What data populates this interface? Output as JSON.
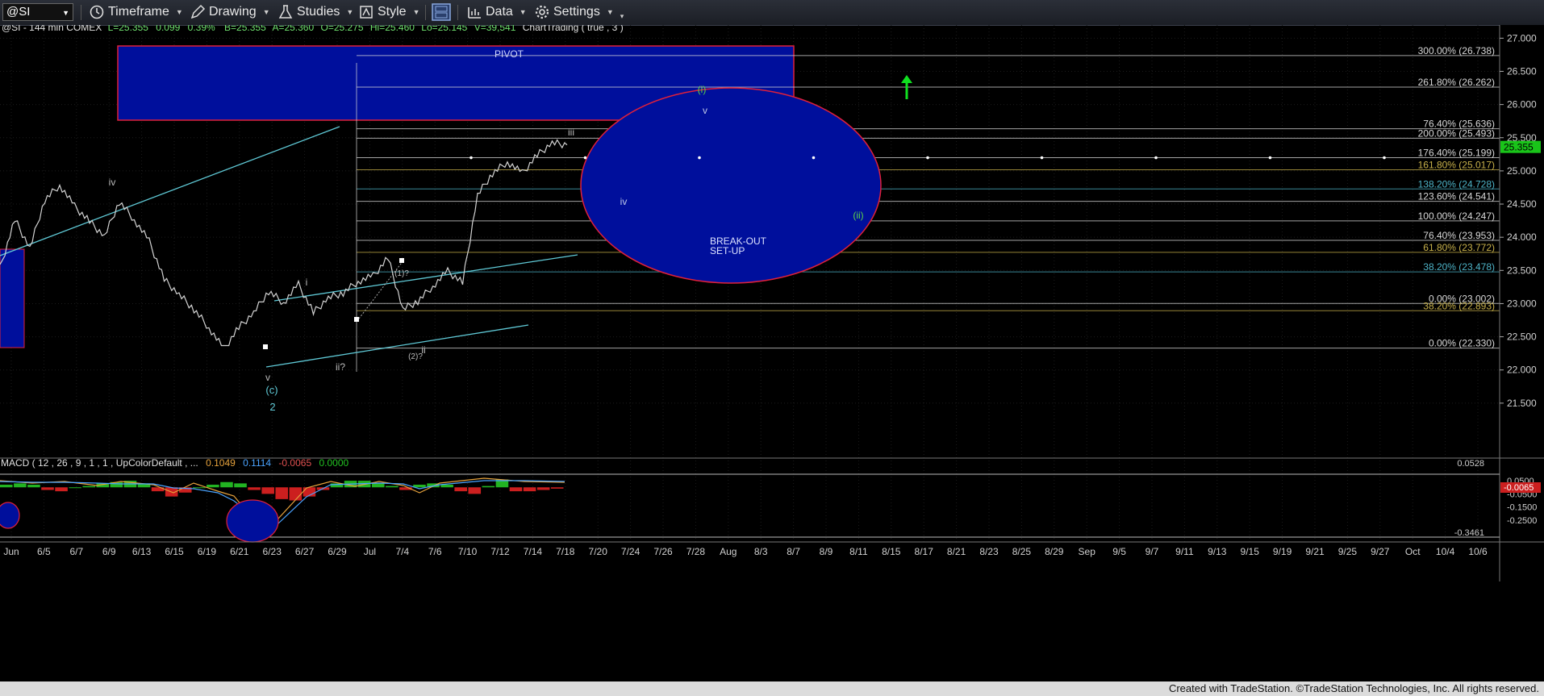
{
  "toolbar": {
    "symbol": "@SI",
    "timeframe": "Timeframe",
    "drawing": "Drawing",
    "studies": "Studies",
    "style": "Style",
    "data": "Data",
    "settings": "Settings"
  },
  "header_line": "@SI - 144 min  COMEX",
  "status": {
    "last": "L=25.355",
    "change": "0.099",
    "pct": "0.39%",
    "bid": "B=25.355",
    "ask": "A=25.360",
    "open": "O=25.275",
    "high": "Hi=25.460",
    "low": "Lo=25.145",
    "volume": "V=39,541",
    "study": "ChartTrading ( true , 3 )"
  },
  "footer": "Created with TradeStation. ©TradeStation Technologies, Inc. All rights reserved.",
  "colors": {
    "background": "#000000",
    "price": "#d3d3d3",
    "cyan_line": "#5fc9d6",
    "zone_fill": "#000f9c",
    "zone_border": "#e0203a",
    "green_arrow": "#10e020",
    "last_price_tag": "#19c419",
    "macd_pos": "#22b322",
    "macd_neg": "#cc1f1f"
  },
  "chart_data": [
    {
      "type": "line",
      "title": "@SI - 144 min  COMEX",
      "ylim": [
        21.0,
        27.15
      ],
      "y_ticks": [
        "27.000",
        "26.500",
        "26.000",
        "25.500",
        "25.000",
        "24.500",
        "24.000",
        "23.500",
        "23.000",
        "22.500",
        "22.000",
        "21.500"
      ],
      "last_price": "25.355",
      "x_ticks": [
        "Jun",
        "6/5",
        "6/7",
        "6/9",
        "6/13",
        "6/15",
        "6/19",
        "6/21",
        "6/23",
        "6/27",
        "6/29",
        "Jul",
        "7/4",
        "7/6",
        "7/10",
        "7/12",
        "7/14",
        "7/18",
        "7/20",
        "7/24",
        "7/26",
        "7/28",
        "Aug",
        "8/3",
        "8/7",
        "8/9",
        "8/11",
        "8/15",
        "8/17",
        "8/21",
        "8/23",
        "8/25",
        "8/29",
        "Sep",
        "9/5",
        "9/7",
        "9/11",
        "9/13",
        "9/15",
        "9/19",
        "9/21",
        "9/25",
        "9/27",
        "Oct",
        "10/4",
        "10/6"
      ],
      "series": [
        {
          "values": [
            23.5,
            24.3,
            23.8,
            24.6,
            24.75,
            24.5,
            24.2,
            24.05,
            24.5,
            24.3,
            23.9,
            23.4,
            23.1,
            22.95,
            22.6,
            22.35,
            22.6,
            22.9,
            23.15,
            23.05,
            23.25,
            22.9,
            23.05,
            23.2,
            23.3,
            23.45,
            23.65,
            22.95,
            23.0,
            23.3,
            23.45,
            23.35,
            24.6,
            25.0,
            25.1,
            25.0,
            25.2,
            25.46,
            25.355
          ]
        }
      ],
      "fib_levels": [
        {
          "label": "300.00% (26.738)",
          "value": 26.738,
          "color": "#d8d8d8"
        },
        {
          "label": "261.80% (26.262)",
          "value": 26.262,
          "color": "#d8d8d8"
        },
        {
          "label": "76.40% (25.636)",
          "value": 25.636,
          "color": "#d8d8d8"
        },
        {
          "label": "200.00% (25.493)",
          "value": 25.493,
          "color": "#d8d8d8"
        },
        {
          "label": "176.40% (25.199)",
          "value": 25.199,
          "color": "#d8d8d8"
        },
        {
          "label": "161.80% (25.017)",
          "value": 25.017,
          "color": "#c7b04a"
        },
        {
          "label": "138.20% (24.728)",
          "value": 24.728,
          "color": "#4db3c7"
        },
        {
          "label": "123.60% (24.541)",
          "value": 24.541,
          "color": "#d8d8d8"
        },
        {
          "label": "100.00% (24.247)",
          "value": 24.247,
          "color": "#d8d8d8"
        },
        {
          "label": "76.40% (23.953)",
          "value": 23.953,
          "color": "#d8d8d8"
        },
        {
          "label": "61.80% (23.772)",
          "value": 23.772,
          "color": "#c7b04a"
        },
        {
          "label": "38.20% (23.478)",
          "value": 23.478,
          "color": "#4db3c7"
        },
        {
          "label": "0.00% (23.002)",
          "value": 23.002,
          "color": "#d8d8d8"
        },
        {
          "label": "38.20% (22.893)",
          "value": 22.893,
          "color": "#c7b04a"
        },
        {
          "label": "0.00% (22.330)",
          "value": 22.33,
          "color": "#d8d8d8"
        }
      ],
      "annotations": [
        "PIVOT",
        "BREAK-OUT",
        "SET-UP",
        "(i)",
        "v",
        "iii",
        "iv",
        "(ii)",
        "iv",
        "i",
        "(1)?",
        "ii",
        "(2)?",
        "ii?",
        "v",
        "(c)",
        "2"
      ]
    },
    {
      "type": "bar",
      "title": "MACD ( 12 , 26 , 9 , 1 , 1 , UpColorDefault , ...",
      "legend_values": [
        "0.1049",
        "0.1114",
        "-0.0065",
        "0.0000"
      ],
      "ylim": [
        -0.38,
        0.1
      ],
      "y_ticks": [
        "0.0500",
        "-0.0500",
        "-0.1500",
        "-0.2500"
      ],
      "edge_labels": [
        "0.0528",
        "-0.3461"
      ],
      "last_value_tag": "-0.0065",
      "histogram": [
        0.02,
        0.03,
        0.02,
        -0.02,
        -0.03,
        0.0,
        0.01,
        0.03,
        0.04,
        0.05,
        0.03,
        -0.03,
        -0.07,
        -0.04,
        0.0,
        0.02,
        0.04,
        0.03,
        -0.02,
        -0.05,
        -0.09,
        -0.1,
        -0.07,
        -0.02,
        0.03,
        0.05,
        0.05,
        0.03,
        0.01,
        -0.02,
        0.02,
        0.03,
        0.02,
        -0.03,
        -0.05,
        0.01,
        0.06,
        -0.03,
        -0.03,
        -0.02,
        -0.01
      ]
    }
  ]
}
